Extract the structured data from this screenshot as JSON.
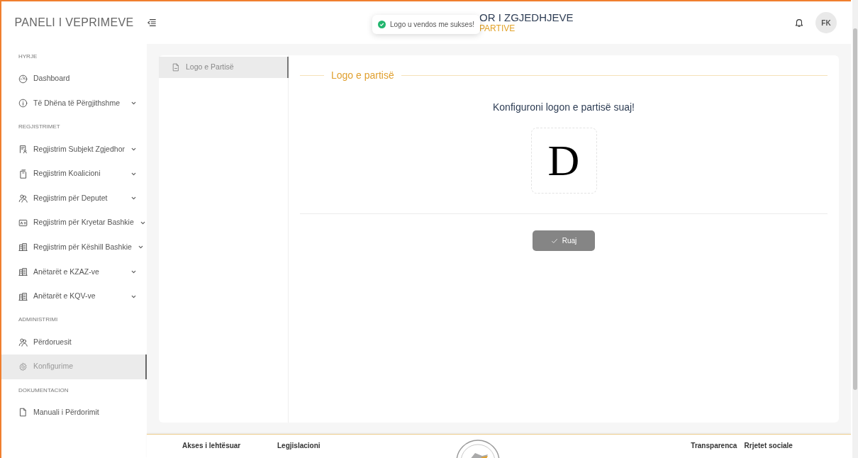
{
  "header": {
    "brand": "PANELI I VEPRIMEVE",
    "title": "OR I ZGJEDHJEVE",
    "subtitle": "PARTIVE",
    "avatar": "FK"
  },
  "toast": {
    "message": "Logo u vendos me sukses!"
  },
  "sidebar": {
    "sections": [
      {
        "title": "HYRJE",
        "items": [
          {
            "label": "Dashboard",
            "expandable": false,
            "selected": false
          },
          {
            "label": "Të Dhëna të Përgjithshme",
            "expandable": true,
            "selected": false
          }
        ]
      },
      {
        "title": "REGJISTRIMET",
        "items": [
          {
            "label": "Regjistrim Subjekt Zgjedhor",
            "expandable": true,
            "selected": false
          },
          {
            "label": "Regjistrim Koalicioni",
            "expandable": true,
            "selected": false
          },
          {
            "label": "Regjistrim për Deputet",
            "expandable": true,
            "selected": false
          },
          {
            "label": "Regjistrim për Kryetar Bashkie",
            "expandable": true,
            "selected": false
          },
          {
            "label": "Regjistrim për Këshill Bashkie",
            "expandable": true,
            "selected": false
          },
          {
            "label": "Anëtarët e KZAZ-ve",
            "expandable": true,
            "selected": false
          },
          {
            "label": "Anëtarët e KQV-ve",
            "expandable": true,
            "selected": false
          }
        ]
      },
      {
        "title": "ADMINISTRIMI",
        "items": [
          {
            "label": "Përdoruesit",
            "expandable": false,
            "selected": false
          },
          {
            "label": "Konfigurime",
            "expandable": false,
            "selected": true
          }
        ]
      },
      {
        "title": "DOKUMENTACION",
        "items": [
          {
            "label": "Manuali i Përdorimit",
            "expandable": false,
            "selected": false
          }
        ]
      }
    ]
  },
  "tabs": [
    {
      "label": "Logo e Partisë",
      "selected": true
    }
  ],
  "panel": {
    "legend": "Logo e partisë",
    "prompt": "Konfiguroni logon e partisë suaj!",
    "logo_letter": "D",
    "save_button": "Ruaj"
  },
  "footer": {
    "columns": [
      {
        "title": "Akses i lehtësuar"
      },
      {
        "title": "Legjislacioni"
      }
    ],
    "right_columns": [
      {
        "title": "Transparenca"
      },
      {
        "title": "Rrjetet sociale"
      }
    ]
  }
}
